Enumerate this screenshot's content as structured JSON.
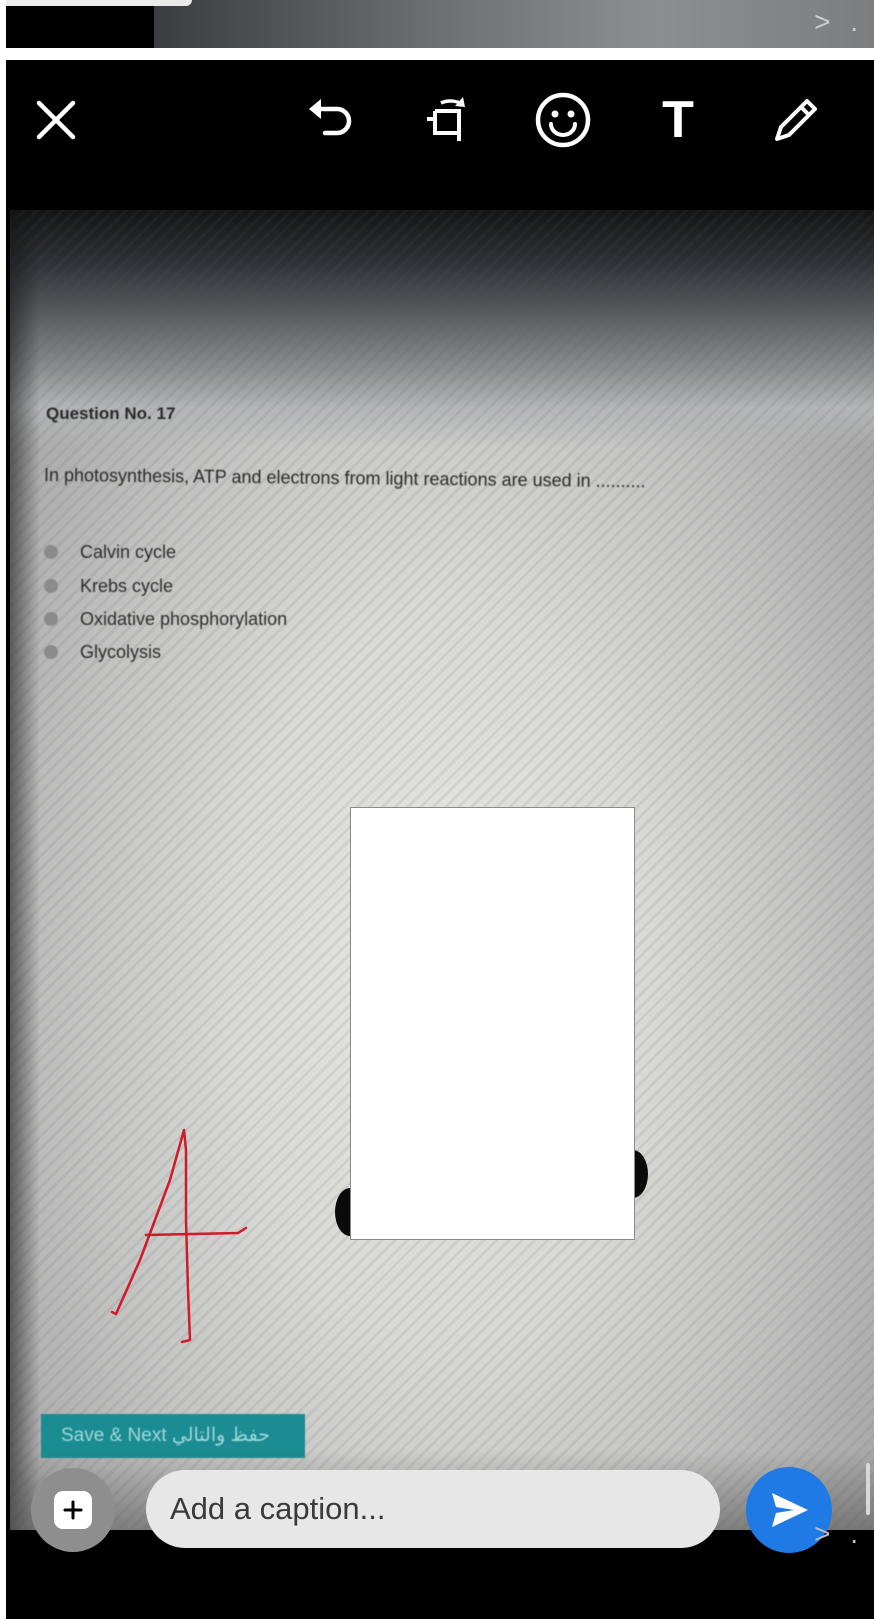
{
  "previous_screen": {
    "more_glyph": "> ."
  },
  "toolbar": {
    "close_icon": "close-icon",
    "undo_icon": "undo-icon",
    "crop_rotate_icon": "crop-rotate-icon",
    "emoji_icon": "emoji-icon",
    "text_tool_label": "T",
    "pen_icon": "pen-icon"
  },
  "photo": {
    "question_number": "Question No. 17",
    "question_text": "In photosynthesis, ATP and electrons from light reactions are used in ..........",
    "options": [
      "Calvin cycle",
      "Krebs cycle",
      "Oxidative phosphorylation",
      "Glycolysis"
    ],
    "save_button": "Save & Next حفظ والتالي",
    "drawing_color": "#d11a2a",
    "redaction_color": "#ffffff"
  },
  "caption": {
    "placeholder": "Add a caption...",
    "add_media_icon": "plus-icon",
    "send_icon": "send-icon",
    "accent_color": "#1f7ae6"
  },
  "footer": {
    "more_glyph": "> ."
  }
}
